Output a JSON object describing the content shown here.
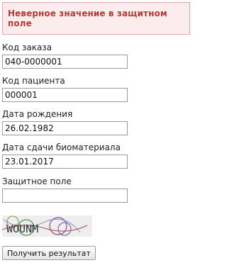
{
  "error": {
    "message": "Неверное значение в защитном поле"
  },
  "form": {
    "fields": [
      {
        "label": "Код заказа",
        "value": "040-0000001"
      },
      {
        "label": "Код пациента",
        "value": "000001"
      },
      {
        "label": "Дата рождения",
        "value": "26.02.1982"
      },
      {
        "label": "Дата сдачи биоматериала",
        "value": "23.01.2017"
      },
      {
        "label": "Защитное поле",
        "value": ""
      }
    ],
    "captcha_text": "WOUNM",
    "submit_label": "Получить результат"
  }
}
